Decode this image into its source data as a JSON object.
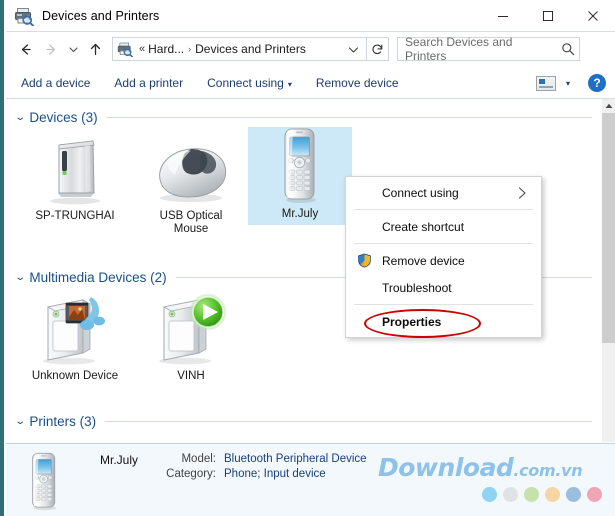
{
  "window": {
    "title": "Devices and Printers",
    "icon": "devices-printers-icon",
    "minimize_label": "—",
    "maximize_label": "☐",
    "close_label": "✕"
  },
  "addressbar": {
    "back_label": "←",
    "forward_label": "→",
    "recent_label": "⌄",
    "up_label": "↑",
    "breadcrumb_separator_double": "«",
    "breadcrumb_separator": "›",
    "crumb_parent": "Hard...",
    "crumb_current": "Devices and Printers",
    "dropdown_label": "⌄",
    "refresh_label": "↻",
    "search_placeholder": "Search Devices and Printers"
  },
  "toolbar": {
    "items": [
      {
        "label": "Add a device",
        "has_caret": false
      },
      {
        "label": "Add a printer",
        "has_caret": false
      },
      {
        "label": "Connect using",
        "has_caret": true
      },
      {
        "label": "Remove device",
        "has_caret": false
      }
    ],
    "caret": "▾",
    "view_icon": "view-layout-icon",
    "view_caret": "▾",
    "help_label": "?"
  },
  "groups": [
    {
      "title": "Devices (3)",
      "chevron": "⌄"
    },
    {
      "title": "Multimedia Devices (2)",
      "chevron": "⌄"
    },
    {
      "title": "Printers (3)",
      "chevron": "⌄"
    }
  ],
  "devices": [
    {
      "label": "SP-TRUNGHAI",
      "icon": "external-drive-icon",
      "selected": false
    },
    {
      "label": "USB Optical Mouse",
      "icon": "mouse-icon",
      "selected": false
    },
    {
      "label": "Mr.July",
      "icon": "phone-icon",
      "selected": true
    }
  ],
  "multimedia": [
    {
      "label": "Unknown Device",
      "icon": "media-tower-icon",
      "selected": false
    },
    {
      "label": "VINH",
      "icon": "play-tower-icon",
      "selected": false
    }
  ],
  "context_menu": {
    "items": [
      {
        "label": "Connect using",
        "submenu": true,
        "shield": false,
        "bold": false,
        "highlighted": false
      },
      {
        "label": "Create shortcut",
        "submenu": false,
        "shield": false,
        "bold": false,
        "highlighted": false
      },
      {
        "label": "Remove device",
        "submenu": false,
        "shield": true,
        "bold": false,
        "highlighted": false
      },
      {
        "label": "Troubleshoot",
        "submenu": false,
        "shield": false,
        "bold": false,
        "highlighted": false
      },
      {
        "label": "Properties",
        "submenu": false,
        "shield": false,
        "bold": true,
        "highlighted": true
      }
    ],
    "submenu_arrow": "›",
    "highlight_color": "#cc0000"
  },
  "details": {
    "name": "Mr.July",
    "icon": "phone-icon",
    "rows": [
      {
        "key": "Model:",
        "value": "Bluetooth Peripheral Device"
      },
      {
        "key": "Category:",
        "value": "Phone; Input device"
      }
    ]
  },
  "watermark": {
    "main": "Download",
    "suffix": ".com.vn",
    "color": "#8ec2e8",
    "dots": [
      "#6ec8ef",
      "#d8dcde",
      "#b7da92",
      "#f6ca83",
      "#7fa9d4",
      "#ef8a9c"
    ]
  },
  "scrollbar": {
    "up_arrow": "▲"
  }
}
